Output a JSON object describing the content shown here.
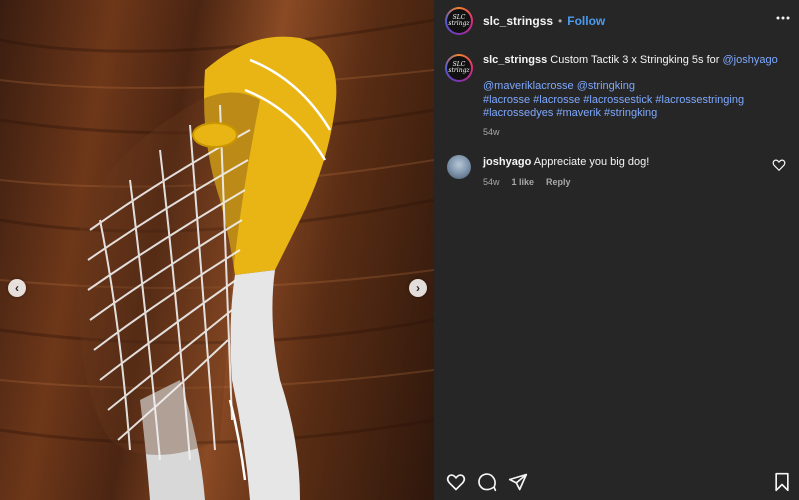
{
  "post": {
    "username": "slc_stringss",
    "avatar_text": "SLC stringz",
    "follow_label": "Follow",
    "separator": "•",
    "more_icon": "more-horizontal-icon"
  },
  "caption": {
    "username": "slc_stringss",
    "text": "Custom Tactik 3 x Stringking 5s for",
    "mention": "@joshyago",
    "tags_line1": "@maveriklacrosse @stringking",
    "tags_line2": "#lacrosse #lacrosse #lacrossestick #lacrossestringing",
    "tags_line3": "#lacrossedyes #maverik #stringking",
    "time": "54w"
  },
  "comment": {
    "username": "joshyago",
    "text": "Appreciate you big dog!",
    "time": "54w",
    "likes": "1 like",
    "reply_label": "Reply"
  },
  "actions": {
    "like_icon": "heart-icon",
    "comment_icon": "comment-bubble-icon",
    "share_icon": "paper-plane-icon",
    "save_icon": "bookmark-icon"
  },
  "carousel": {
    "prev_glyph": "‹",
    "next_glyph": "›"
  },
  "colors": {
    "panel_bg": "#262626",
    "link": "#7ea9ff",
    "follow": "#4a9cf0",
    "head_yellow": "#e8b514",
    "head_white": "#e6e6e6"
  }
}
